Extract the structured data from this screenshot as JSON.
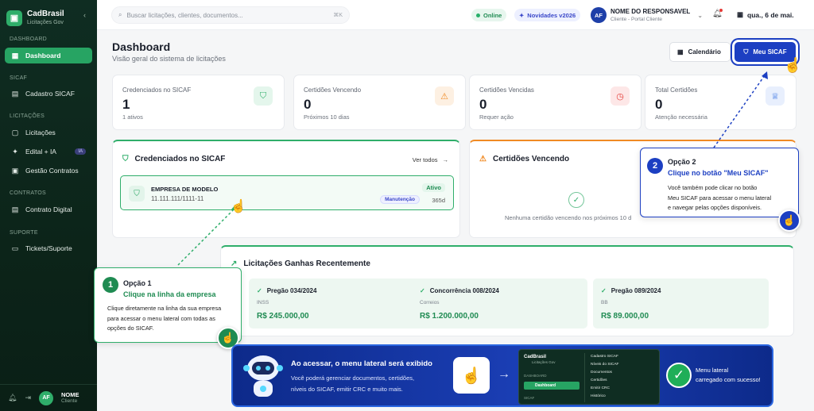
{
  "brand": {
    "name": "CadBrasil",
    "sub": "Licitações Gov"
  },
  "sidebar": {
    "sections": [
      "DASHBOARD",
      "SICAF",
      "LICITAÇÕES",
      "CONTRATOS",
      "SUPORTE"
    ],
    "items": [
      {
        "label": "Dashboard",
        "icon": "grid-icon"
      },
      {
        "label": "Cadastro SICAF",
        "icon": "document-icon"
      },
      {
        "label": "Licitações",
        "icon": "file-icon"
      },
      {
        "label": "Edital + IA",
        "icon": "sparkle-icon",
        "badge": "IA"
      },
      {
        "label": "Gestão Contratos",
        "icon": "briefcase-icon"
      },
      {
        "label": "Contrato Digital",
        "icon": "file-sign-icon"
      },
      {
        "label": "Tickets/Suporte",
        "icon": "ticket-icon"
      }
    ],
    "footer": {
      "avatar": "AF",
      "name": "NOME",
      "role": "Cliente"
    }
  },
  "topbar": {
    "search_placeholder": "Buscar licitações, clientes, documentos...",
    "shortcut": "⌘K",
    "status": "Online",
    "news": "Novidades v2026",
    "user": {
      "avatar": "AF",
      "name": "NOME DO RESPONSAVEL",
      "role": "Cliente - Portal Cliente"
    },
    "date": "qua., 6 de mai."
  },
  "page": {
    "title": "Dashboard",
    "subtitle": "Visão geral do sistema de licitações",
    "calendar_btn": "Calendário",
    "sicaf_btn": "Meu SICAF"
  },
  "stats": [
    {
      "label": "Credenciados no SICAF",
      "value": "1",
      "sub": "1 ativos",
      "icon": "shield-icon",
      "color": "#2fae6a"
    },
    {
      "label": "Certidões Vencendo",
      "value": "0",
      "sub": "Próximos 10 dias",
      "icon": "warning-icon",
      "color": "#f08a24"
    },
    {
      "label": "Certidões Vencidas",
      "value": "0",
      "sub": "Requer ação",
      "icon": "clock-icon",
      "color": "#e53935"
    },
    {
      "label": "Total Certidões",
      "value": "0",
      "sub": "Atenção necessária",
      "icon": "badge-icon",
      "color": "#2d6be0"
    }
  ],
  "credenciados": {
    "title": "Credenciados no SICAF",
    "link": "Ver todos",
    "company": {
      "name": "EMPRESA DE MODELO",
      "cnpj": "11.111.111/1111-11",
      "status": "Ativo",
      "tag": "Manutenção",
      "days": "365d"
    }
  },
  "vencendo": {
    "title": "Certidões Vencendo",
    "empty": "Nenhuma certidão vencendo nos próximos 10 d"
  },
  "ganhas": {
    "title": "Licitações Ganhas Recentemente",
    "items": [
      {
        "title": "Pregão 034/2024",
        "client": "INSS",
        "value": "R$ 245.000,00"
      },
      {
        "title": "Concorrência 008/2024",
        "client": "Correios",
        "value": "R$ 1.200.000,00"
      },
      {
        "title": "Pregão 089/2024",
        "client": "BB",
        "value": "R$ 89.000,00"
      }
    ]
  },
  "option1": {
    "num": "1",
    "head": "Opção 1",
    "title": "Clique na linha da empresa",
    "body": [
      "Clique diretamente na linha da sua empresa",
      "para acessar o menu lateral com todas as",
      "opções do SICAF."
    ]
  },
  "option2": {
    "num": "2",
    "head": "Opção 2",
    "title": "Clique no botão \"Meu SICAF\"",
    "body": [
      "Você também pode clicar no botão",
      "Meu SICAF para acessar o menu lateral",
      "e navegar pelas opções disponíveis."
    ]
  },
  "banner": {
    "title": "Ao acessar, o menu lateral será exibido",
    "text": [
      "Você poderá gerenciar documentos, certidões,",
      "níveis do SICAF, emitir CRC e muito mais."
    ],
    "mini": {
      "brand": "CadBrasil",
      "brand_sub": "Licitações Gov",
      "sec1": "DASHBOARD",
      "active": "Dashboard",
      "sec2": "SICAF",
      "items": [
        "Cadastro SICAF",
        "Níveis do SICAF",
        "Documentos",
        "Certidões",
        "Emitir CRC",
        "Histórico"
      ]
    },
    "done": [
      "Menu lateral",
      "carregado com sucesso!"
    ]
  },
  "colors": {
    "brand_green": "#2fae6a",
    "primary_blue": "#1c3fc2",
    "sidebar_bg": "#0f2d22"
  }
}
